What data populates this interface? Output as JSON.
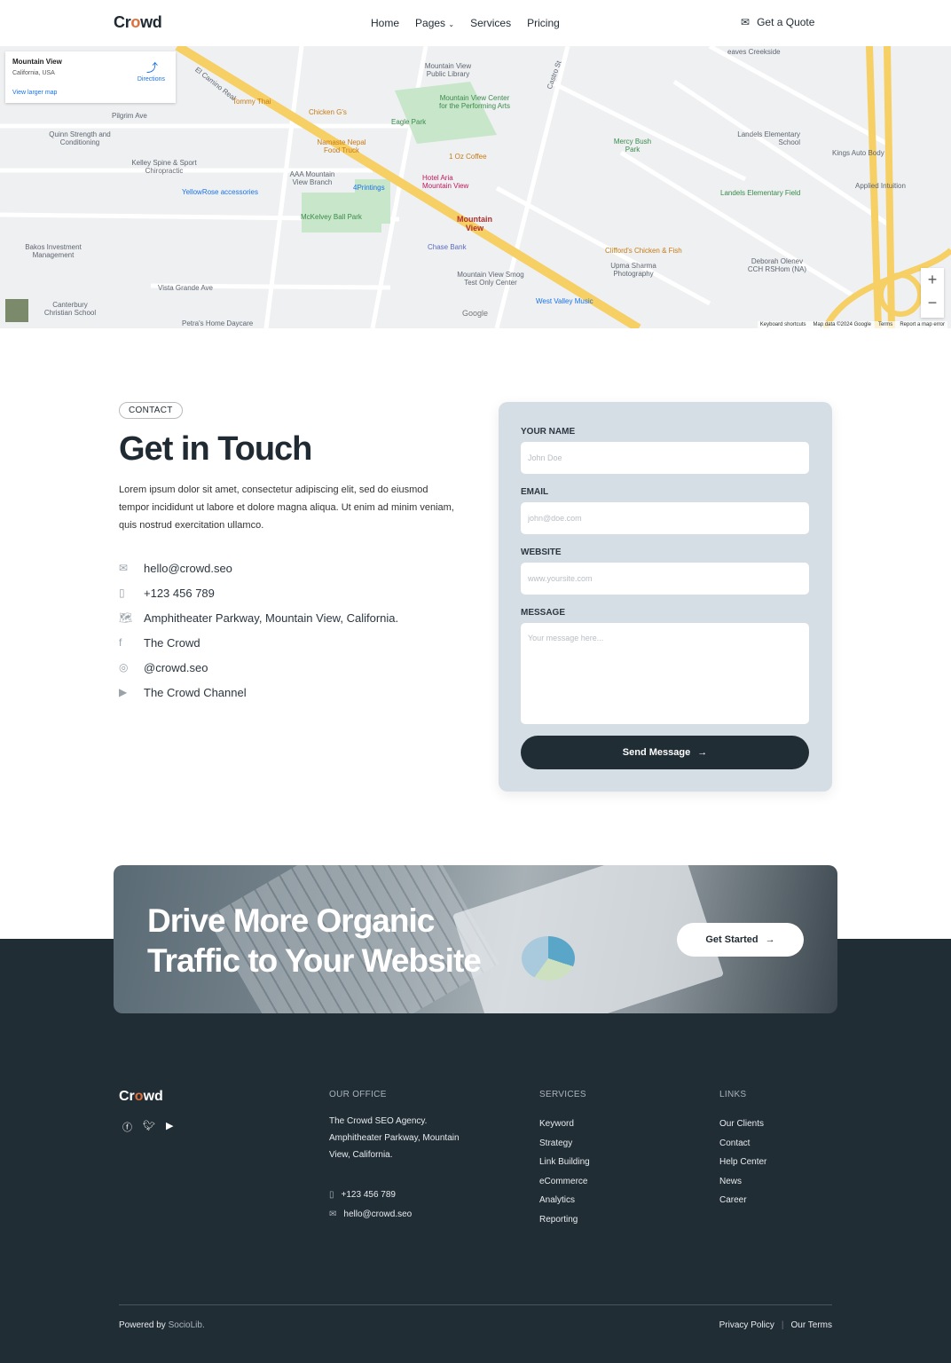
{
  "nav": {
    "logo_pre": "Cr",
    "logo_o": "o",
    "logo_post": "wd",
    "items": [
      {
        "label": "Home"
      },
      {
        "label": "Pages"
      },
      {
        "label": "Services"
      },
      {
        "label": "Pricing"
      }
    ],
    "quote": "Get a Quote"
  },
  "map": {
    "card": {
      "title": "Mountain View",
      "subtitle": "California, USA",
      "larger": "View larger map",
      "directions": "Directions"
    },
    "labels": [
      "El Camino Real",
      "Tommy Thai",
      "Chicken G's",
      "Mountain View Public Library",
      "Mountain View Center for the Performing Arts",
      "Eagle Park",
      "Namaste Nepal Food Truck",
      "1 Oz Coffee",
      "Hotel Aria Mountain View",
      "Mountain View",
      "Chase Bank",
      "McKelvey Ball Park",
      "YellowRose accessories",
      "Kelley Spine & Sport Chiropractic",
      "Quinn Strength and Conditioning",
      "Bakos Investment Management",
      "Canterbury Christian School",
      "Petra's Home Daycare",
      "Mountain View Smog Test Only Center",
      "West Valley Music",
      "Clifford's Chicken & Fish",
      "Upma Sharma Photography",
      "Mercy Bush Park",
      "Landels Elementary School",
      "Landels Elementary Field",
      "Deborah Olenev CCH RSHom (NA)",
      "Kings Auto Body",
      "Applied Intuition",
      "eaves Creekside",
      "Castro St",
      "Pilgrim Ave",
      "Vista Grande Ave",
      "AAA Mountain View Branch",
      "4Printings"
    ],
    "zoom_in": "+",
    "zoom_out": "−",
    "attribution": [
      "Keyboard shortcuts",
      "Map data ©2024 Google",
      "Terms",
      "Report a map error"
    ],
    "google": "Google"
  },
  "contact": {
    "tag": "CONTACT",
    "title": "Get in Touch",
    "lead": "Lorem ipsum dolor sit amet, consectetur adipiscing elit, sed do eiusmod tempor incididunt ut labore et dolore magna aliqua. Ut enim ad minim veniam, quis nostrud exercitation ullamco.",
    "items": [
      {
        "icon": "mail-icon",
        "text": "hello@crowd.seo"
      },
      {
        "icon": "phone-icon",
        "text": "+123 456 789"
      },
      {
        "icon": "map-icon",
        "text": "Amphitheater Parkway, Mountain View, California."
      },
      {
        "icon": "facebook-icon",
        "text": "The Crowd"
      },
      {
        "icon": "instagram-icon",
        "text": "@crowd.seo"
      },
      {
        "icon": "youtube-icon",
        "text": "The Crowd Channel"
      }
    ]
  },
  "form": {
    "name_label": "YOUR NAME",
    "name_placeholder": "John Doe",
    "email_label": "EMAIL",
    "email_placeholder": "john@doe.com",
    "website_label": "WEBSITE",
    "website_placeholder": "www.yoursite.com",
    "message_label": "MESSAGE",
    "message_placeholder": "Your message here...",
    "submit": "Send Message"
  },
  "banner": {
    "line1": "Drive More Organic",
    "line2": "Traffic to Your Website",
    "cta": "Get Started"
  },
  "footer": {
    "logo_pre": "Cr",
    "logo_o": "o",
    "logo_post": "wd",
    "office_heading": "OUR OFFICE",
    "office_address": "The Crowd SEO Agency. Amphitheater Parkway, Mountain View, California.",
    "phone": "+123 456 789",
    "email": "hello@crowd.seo",
    "services_heading": "SERVICES",
    "services": [
      "Keyword",
      "Strategy",
      "Link Building",
      "eCommerce",
      "Analytics",
      "Reporting"
    ],
    "links_heading": "LINKS",
    "links": [
      "Our Clients",
      "Contact",
      "Help Center",
      "News",
      "Career"
    ],
    "powered_pre": "Powered by",
    "powered_brand": "SocioLib.",
    "privacy": "Privacy Policy",
    "terms": "Our Terms"
  },
  "colors": {
    "accent": "#e0703a",
    "dark": "#212d35",
    "form_bg": "#d5dee4"
  }
}
